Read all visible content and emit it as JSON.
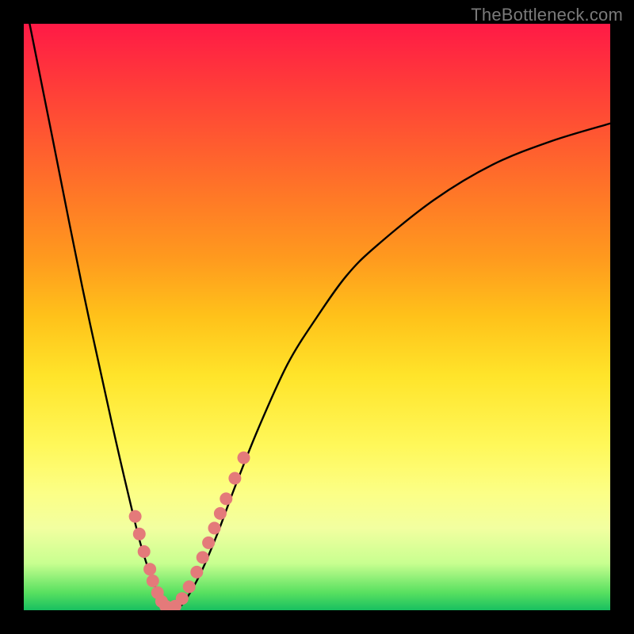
{
  "watermark": "TheBottleneck.com",
  "colors": {
    "black_frame": "#000000",
    "dot": "#e47a7a",
    "curve": "#000000"
  },
  "chart_data": {
    "type": "line",
    "title": "",
    "xlabel": "",
    "ylabel": "",
    "xlim": [
      0,
      100
    ],
    "ylim": [
      0,
      100
    ],
    "series": [
      {
        "name": "bottleneck-curve",
        "x": [
          1,
          5,
          10,
          15,
          18,
          20,
          22,
          24,
          25,
          27,
          30,
          33,
          36,
          40,
          45,
          50,
          55,
          60,
          70,
          80,
          90,
          100
        ],
        "y": [
          100,
          80,
          55,
          32,
          19,
          11,
          5,
          1,
          0,
          1,
          6,
          13,
          21,
          31,
          42,
          50,
          57,
          62,
          70,
          76,
          80,
          83
        ]
      }
    ],
    "highlight_points": {
      "name": "marked-dots",
      "x": [
        19.0,
        19.7,
        20.5,
        21.5,
        22.0,
        22.8,
        23.5,
        24.2,
        25.0,
        25.8,
        27.0,
        28.2,
        29.5,
        30.5,
        31.5,
        32.5,
        33.5,
        34.5,
        36.0,
        37.5
      ],
      "y": [
        16.0,
        13.0,
        10.0,
        7.0,
        5.0,
        3.0,
        1.5,
        0.7,
        0.4,
        0.7,
        2.0,
        4.0,
        6.5,
        9.0,
        11.5,
        14.0,
        16.5,
        19.0,
        22.5,
        26.0
      ]
    }
  }
}
